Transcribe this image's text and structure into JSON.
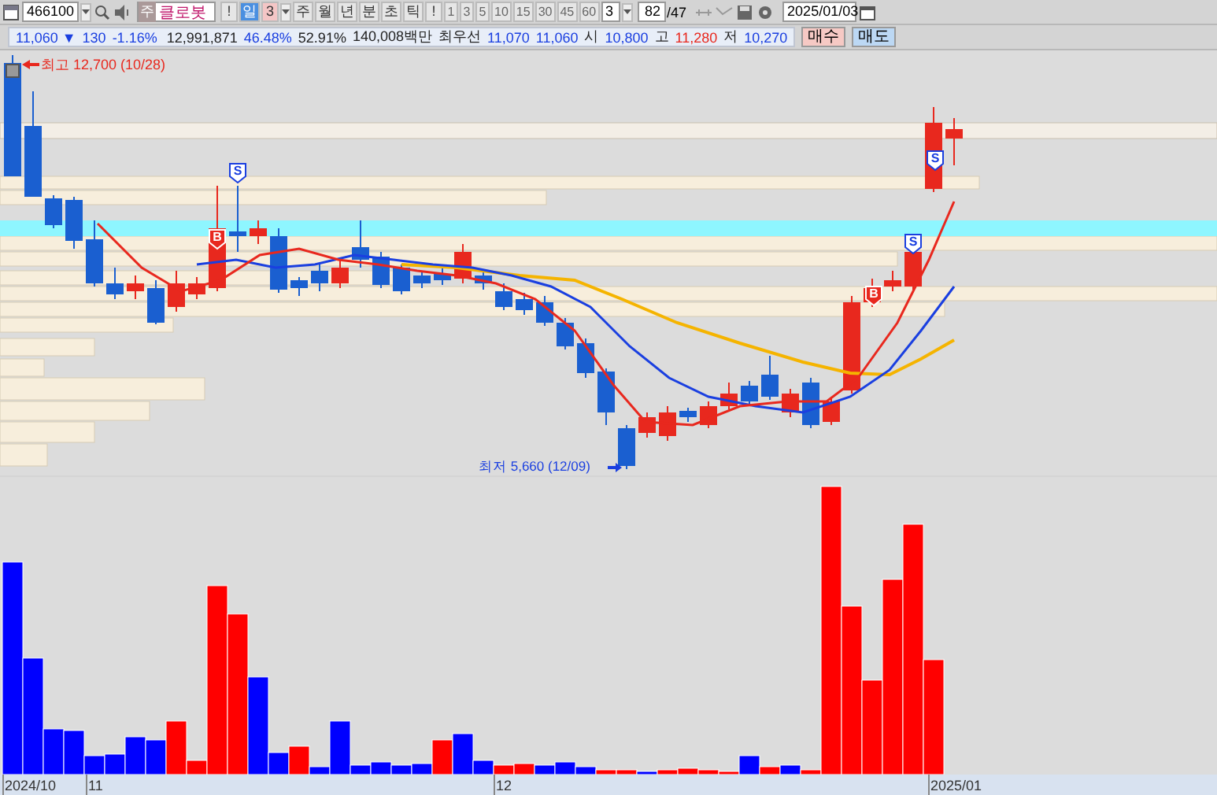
{
  "toolbar": {
    "code": "466100",
    "name": "클로봇",
    "name_prefix": "주",
    "alert": "!",
    "periods": [
      {
        "label": "일",
        "selected": true
      },
      {
        "label": "3",
        "selected": false
      },
      {
        "label": "주",
        "selected": false
      },
      {
        "label": "월",
        "selected": false
      },
      {
        "label": "년",
        "selected": false
      },
      {
        "label": "분",
        "selected": false
      },
      {
        "label": "초",
        "selected": false
      },
      {
        "label": "틱",
        "selected": false
      }
    ],
    "alert2": "!",
    "intervals": [
      "1",
      "3",
      "5",
      "10",
      "15",
      "30",
      "45",
      "60"
    ],
    "interval_value": "3",
    "count": "82",
    "total": "/47",
    "date": "2025/01/03"
  },
  "quote": {
    "price": "11,060 ▼",
    "change": "130",
    "rate": "-1.16%",
    "volume": "12,991,871",
    "ratio1": "46.48%",
    "ratio2": "52.91%",
    "amount": "140,008백만",
    "best_label": "최우선",
    "ask": "11,070",
    "bid": "11,060",
    "open_label": "시",
    "open": "10,800",
    "high_label": "고",
    "high": "11,280",
    "low_label": "저",
    "low": "10,270",
    "buy": "매수",
    "sell": "매도"
  },
  "chart": {
    "high_note": "최고 12,700 (10/28)",
    "low_note": "최저 5,660 (12/09)",
    "signals": [
      {
        "kind": "buy",
        "label": "B"
      },
      {
        "kind": "sell",
        "label": "S"
      },
      {
        "kind": "buy",
        "label": "B"
      },
      {
        "kind": "sell",
        "label": "S"
      },
      {
        "kind": "sell",
        "label": "S"
      }
    ],
    "x_labels": [
      "2024/10",
      "11",
      "12",
      "2025/01"
    ]
  }
}
